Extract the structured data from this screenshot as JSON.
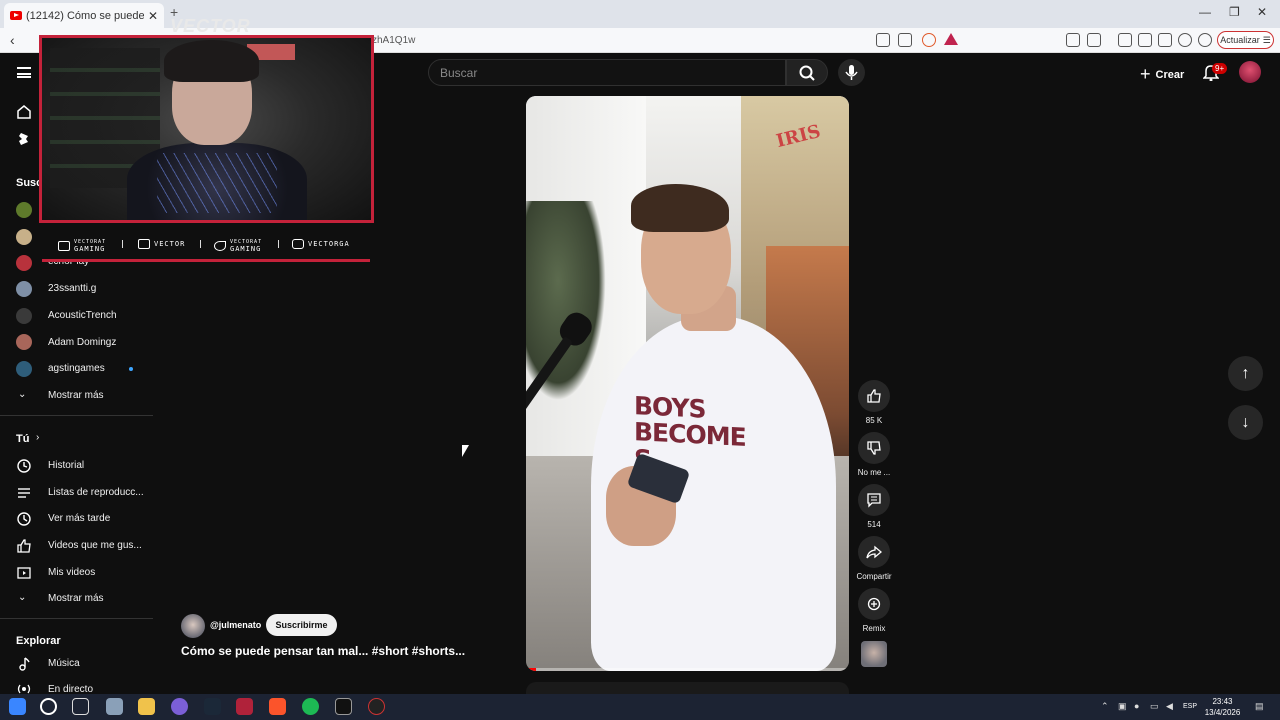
{
  "browser": {
    "tab_title": "(12142) Cómo se puede pen",
    "tab_close": "✕",
    "new_tab": "+",
    "url_fragment": "zhA1Q1w",
    "update_label": "Actualizar",
    "window_controls": [
      "—",
      "❐",
      "✕"
    ]
  },
  "header": {
    "search_placeholder": "Buscar",
    "create_label": "Crear",
    "notifications_badge": "9+"
  },
  "sidebar": {
    "subscriptions_heading": "Susc",
    "channels": [
      {
        "name": "echoPlay",
        "color": "#b8323c"
      },
      {
        "name": "23ssantti.g",
        "color": "#7e8fa6"
      },
      {
        "name": "AcousticTrench",
        "color": "#3a3a3a"
      },
      {
        "name": "Adam Domingz",
        "color": "#a8665a"
      },
      {
        "name": "agstingames",
        "color": "#2e5d7a"
      }
    ],
    "show_more_1": "Mostrar más",
    "you_heading": "Tú",
    "you_items": [
      "Historial",
      "Listas de reproducc...",
      "Ver más tarde",
      "Videos que me gus...",
      "Mis videos"
    ],
    "show_more_2": "Mostrar más",
    "explore_heading": "Explorar",
    "explore_items": [
      "Música",
      "En directo"
    ]
  },
  "overlay": {
    "logo": "VECTOR",
    "socials": [
      {
        "top": "VECTORAT",
        "bottom": "GAMING",
        "icon": "youtube-icon"
      },
      {
        "top": "VECTOR",
        "bottom": "",
        "icon": "twitch-icon"
      },
      {
        "top": "VECTORAT",
        "bottom": "GAMING",
        "icon": "twitter-icon"
      },
      {
        "top": "VECTORGA",
        "bottom": "",
        "icon": "instagram-icon"
      }
    ]
  },
  "video": {
    "shirt_text": "BOYS\nBECOME\nS",
    "sign_text": "IRIS",
    "progress_fraction": 0.03
  },
  "actions": {
    "likes": "85 K",
    "dislike_label": "No me ...",
    "comments": "514",
    "share_label": "Compartir",
    "remix_label": "Remix"
  },
  "info": {
    "channel_handle": "@julmenato",
    "subscribe_label": "Suscribirme",
    "title": "Cómo se puede pensar tan mal... #short #shorts..."
  },
  "taskbar": {
    "language": "ESP",
    "time": "23:43",
    "date": "13/4/2026"
  },
  "colors": {
    "accent_red": "#c4223a",
    "youtube_red": "#ff0000",
    "background": "#0f0f0f"
  }
}
